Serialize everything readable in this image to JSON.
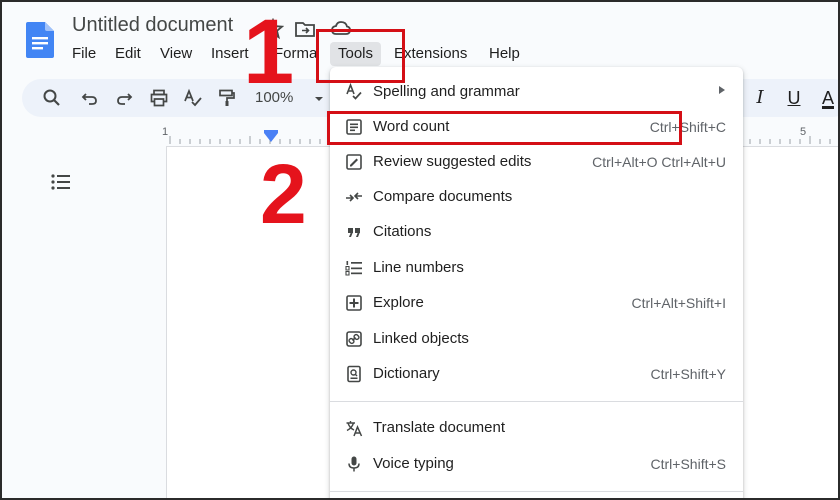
{
  "document": {
    "title": "Untitled document"
  },
  "menubar": {
    "items": [
      "File",
      "Edit",
      "View",
      "Insert",
      "Format",
      "Tools",
      "Extensions",
      "Help"
    ],
    "active": "Tools"
  },
  "toolbar": {
    "zoom": "100%",
    "format_buttons": [
      "I",
      "U",
      "A"
    ]
  },
  "ruler": {
    "labels": [
      "1",
      "5"
    ]
  },
  "tools_menu": {
    "items": [
      {
        "label": "Spelling and grammar",
        "shortcut": "",
        "icon": "spellcheck-icon",
        "submenu": true
      },
      {
        "label": "Word count",
        "shortcut": "Ctrl+Shift+C",
        "icon": "word-count-icon"
      },
      {
        "label": "Review suggested edits",
        "shortcut": "Ctrl+Alt+O Ctrl+Alt+U",
        "icon": "review-edits-icon"
      },
      {
        "label": "Compare documents",
        "shortcut": "",
        "icon": "compare-icon"
      },
      {
        "label": "Citations",
        "shortcut": "",
        "icon": "quote-icon"
      },
      {
        "label": "Line numbers",
        "shortcut": "",
        "icon": "line-numbers-icon"
      },
      {
        "label": "Explore",
        "shortcut": "Ctrl+Alt+Shift+I",
        "icon": "explore-icon"
      },
      {
        "label": "Linked objects",
        "shortcut": "",
        "icon": "linked-objects-icon"
      },
      {
        "label": "Dictionary",
        "shortcut": "Ctrl+Shift+Y",
        "icon": "dictionary-icon"
      },
      {
        "label": "Translate document",
        "shortcut": "",
        "icon": "translate-icon"
      },
      {
        "label": "Voice typing",
        "shortcut": "Ctrl+Shift+S",
        "icon": "microphone-icon"
      }
    ]
  },
  "annotations": {
    "step1": "1",
    "step2": "2"
  },
  "colors": {
    "annotation_red": "#e5131c",
    "menu_highlight": "#e1e3e6",
    "toolbar_bg": "#edf2fa",
    "docs_blue": "#4285f4"
  }
}
